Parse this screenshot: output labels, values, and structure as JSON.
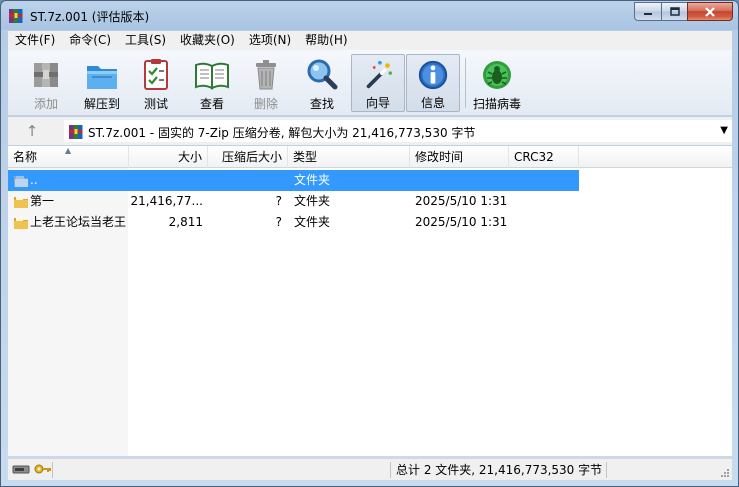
{
  "window": {
    "title": "ST.7z.001 (评估版本)"
  },
  "menu": {
    "items": [
      "文件(F)",
      "命令(C)",
      "工具(S)",
      "收藏夹(O)",
      "选项(N)",
      "帮助(H)"
    ]
  },
  "toolbar": {
    "add": "添加",
    "extract_to": "解压到",
    "test": "测试",
    "view": "查看",
    "delete": "删除",
    "find": "查找",
    "wizard": "向导",
    "info": "信息",
    "virus_scan": "扫描病毒"
  },
  "address": {
    "path": "ST.7z.001 - 固实的 7-Zip 压缩分卷, 解包大小为 21,416,773,530 字节",
    "up_symbol": "↑"
  },
  "columns": {
    "name": "名称",
    "size": "大小",
    "packed": "压缩后大小",
    "type": "类型",
    "modified": "修改时间",
    "crc": "CRC32"
  },
  "rows": [
    {
      "name": "..",
      "size": "",
      "packed": "",
      "type": "文件夹",
      "modified": "",
      "crc": ""
    },
    {
      "name": "第一",
      "size": "21,416,77...",
      "packed": "?",
      "type": "文件夹",
      "modified": "2025/5/10 1:31",
      "crc": ""
    },
    {
      "name": "上老王论坛当老王",
      "size": "2,811",
      "packed": "?",
      "type": "文件夹",
      "modified": "2025/5/10 1:31",
      "crc": ""
    }
  ],
  "status": {
    "summary": "总计 2 文件夹, 21,416,773,530 字节"
  },
  "colors": {
    "selection": "#3399ff",
    "folder": "#e8b640"
  }
}
